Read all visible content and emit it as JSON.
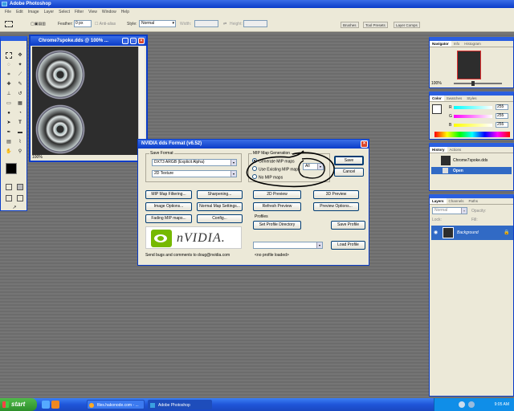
{
  "app": {
    "title": "Adobe Photoshop"
  },
  "menu": [
    "File",
    "Edit",
    "Image",
    "Layer",
    "Select",
    "Filter",
    "View",
    "Window",
    "Help"
  ],
  "options": {
    "feather_label": "Feather:",
    "feather_value": "0 px",
    "antialias_label": "Anti-alias",
    "style_label": "Style:",
    "style_value": "Normal",
    "width_label": "Width:",
    "height_label": "Height:",
    "palette_well": [
      "Brushes",
      "Tool Presets",
      "Layer Comps"
    ]
  },
  "document": {
    "title": "Chrome7spoke.dds @ 100% ...",
    "zoom": "100%"
  },
  "navigator": {
    "tabs": [
      "Navigator",
      "Info",
      "Histogram"
    ],
    "zoom": "100%"
  },
  "color": {
    "tabs": [
      "Color",
      "Swatches",
      "Styles"
    ],
    "channels": [
      {
        "label": "R",
        "value": "255"
      },
      {
        "label": "G",
        "value": "255"
      },
      {
        "label": "B",
        "value": "255"
      }
    ]
  },
  "history": {
    "tabs": [
      "History",
      "Actions"
    ],
    "items": [
      "Chrome7spoke.dds",
      "Open"
    ]
  },
  "layers": {
    "tabs": [
      "Layers",
      "Channels",
      "Paths"
    ],
    "blend_mode": "Normal",
    "opacity_label": "Opacity:",
    "lock_label": "Lock:",
    "fill_label": "Fill:",
    "layer_name": "Background"
  },
  "dialog": {
    "title": "NVIDIA dds Format (v6.52)",
    "save_format_label": "Save Format",
    "format_value": "DXT3     ARGB     (Explicit Alpha)",
    "texture_value": "2D Texture",
    "mip_label": "MIP Map Generation",
    "mip_options": [
      "Generate MIP maps",
      "Use Existing MIP maps",
      "No MIP maps"
    ],
    "mip_count": "All",
    "save": "Save",
    "cancel": "Cancel",
    "buttons_left": [
      "MIP Map Filtering...",
      "Image Options...",
      "Fading MIP maps..."
    ],
    "buttons_mid": [
      "Sharpening...",
      "Normal Map Settings...",
      "Config..."
    ],
    "buttons_preview": [
      "2D Preview",
      "Refresh Preview",
      "3D Preview",
      "Preview Options..."
    ],
    "profiles_label": "Profiles",
    "set_profile_dir": "Set Profile Directory",
    "save_profile": "Save Profile",
    "load_profile": "Load Profile",
    "profile_status": "<no profile loaded>",
    "logo_text": "nVIDIA.",
    "footer": "Send bugs and comments to doug@nvidia.com"
  },
  "taskbar": {
    "start": "start",
    "tasks": [
      "files.hakonode.com - ...",
      "Adobe Photoshop"
    ],
    "time": "9:05 AM"
  }
}
